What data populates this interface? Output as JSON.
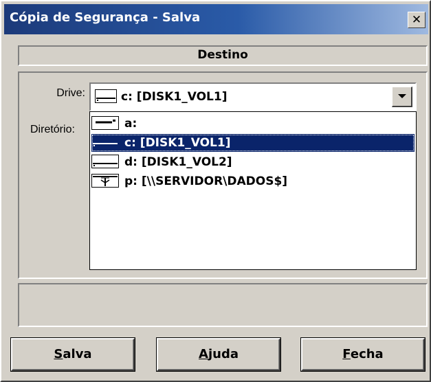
{
  "window": {
    "title": "Cópia de Segurança - Salva",
    "close_label": "✕"
  },
  "section": {
    "header": "Destino"
  },
  "form": {
    "drive_label": "Drive:",
    "directory_label": "Diretório:",
    "drive_selected": "c: [DISK1_VOL1]",
    "drive_selected_icon": "hard-drive-icon"
  },
  "drive_options": [
    {
      "label": "a:",
      "icon": "floppy-drive-icon",
      "selected": false
    },
    {
      "label": "c: [DISK1_VOL1]",
      "icon": "hard-drive-icon",
      "selected": true
    },
    {
      "label": "d: [DISK1_VOL2]",
      "icon": "hard-drive-icon",
      "selected": false
    },
    {
      "label": "p: [\\\\SERVIDOR\\DADOS$]",
      "icon": "network-drive-icon",
      "selected": false
    }
  ],
  "buttons": {
    "save": {
      "accel": "S",
      "rest": "alva"
    },
    "help": {
      "accel": "A",
      "rest": "juda"
    },
    "close": {
      "accel": "F",
      "rest": "echa"
    }
  },
  "colors": {
    "selection": "#0a246a",
    "face": "#d4d0c8",
    "title_start": "#1c3a7a",
    "title_end": "#9fb9e0"
  }
}
